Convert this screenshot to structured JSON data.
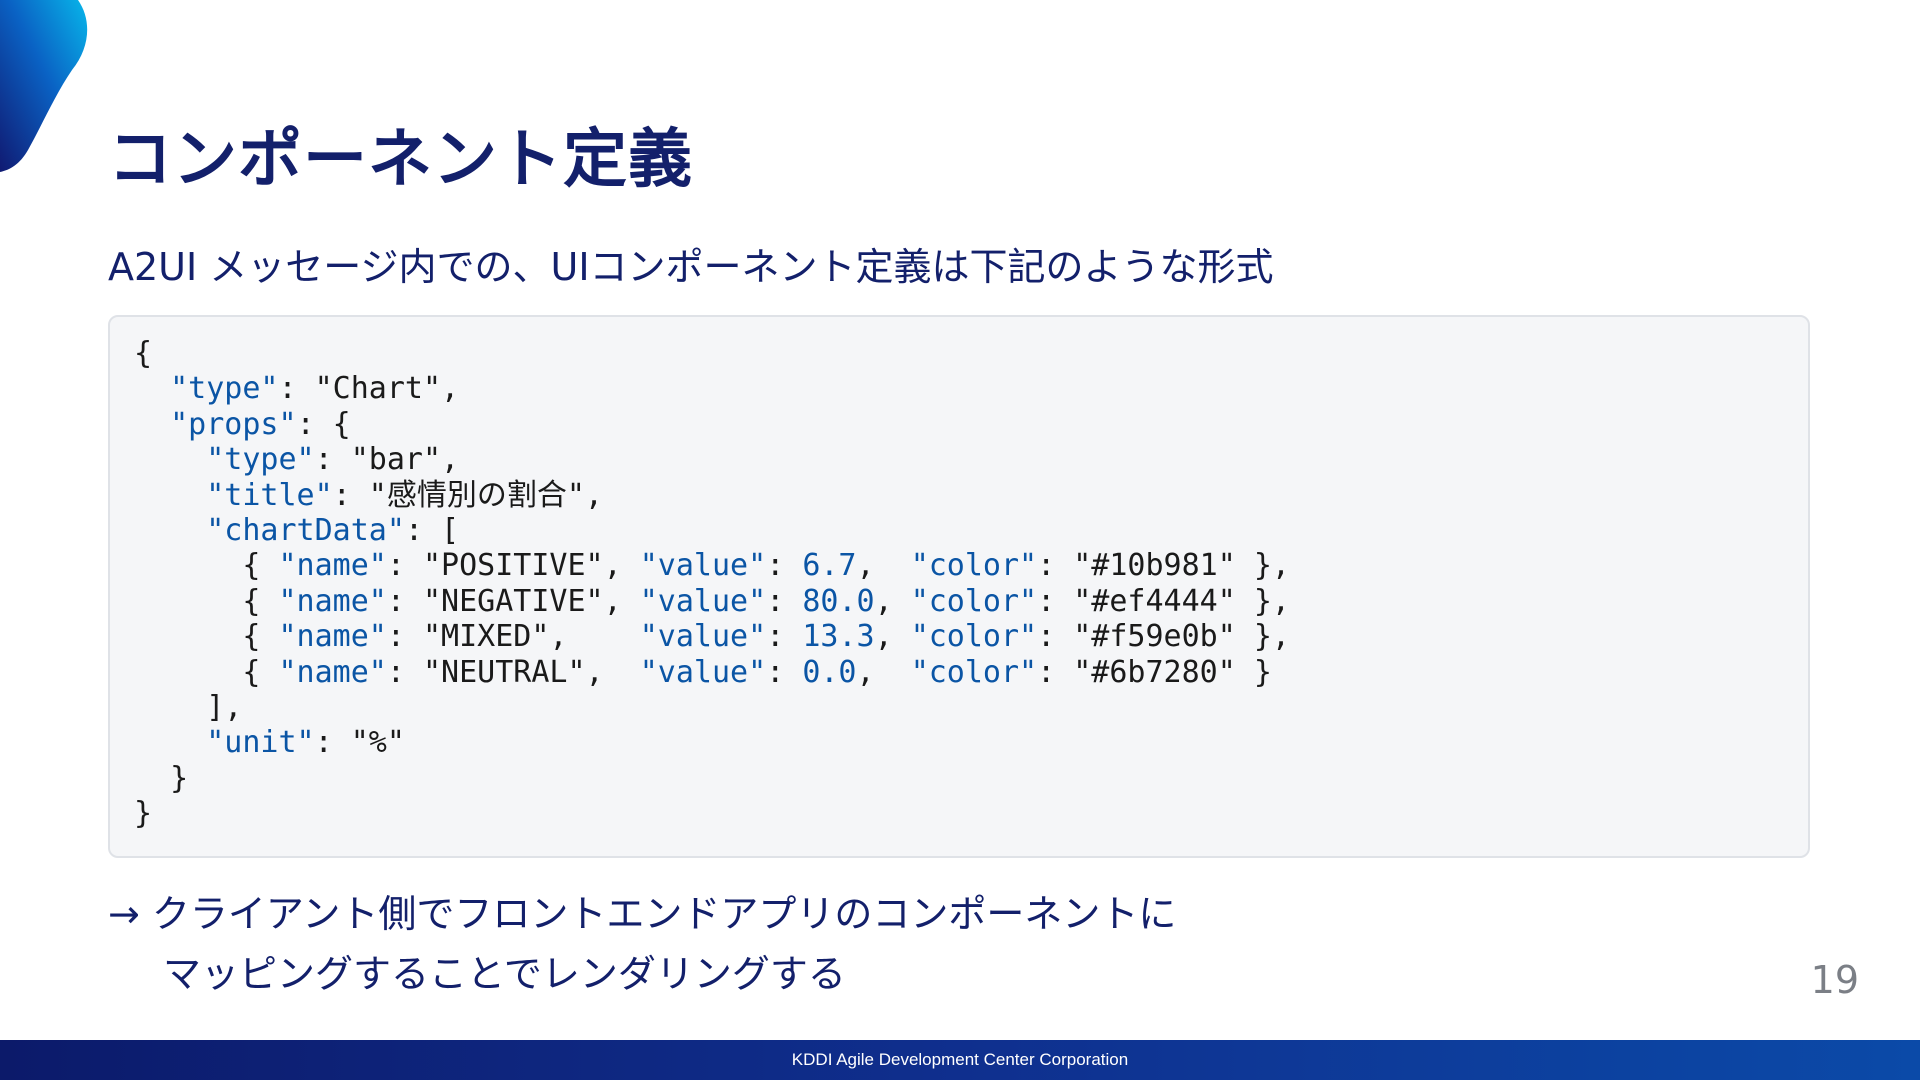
{
  "slide": {
    "title": "コンポーネント定義",
    "subtitle": "A2UI メッセージ内での、UIコンポーネント定義は下記のような形式",
    "conclusion_line1": "→ クライアント側でフロントエンドアプリのコンポーネントに",
    "conclusion_line2": "マッピングすることでレンダリングする",
    "page_number": "19"
  },
  "footer": {
    "company": "KDDI Agile Development Center Corporation"
  },
  "code_example": {
    "lines": [
      "{",
      "  \"type\": \"Chart\",",
      "  \"props\": {",
      "    \"type\": \"bar\",",
      "    \"title\": \"感情別の割合\",",
      "    \"chartData\": [",
      "      { \"name\": \"POSITIVE\", \"value\": 6.7,  \"color\": \"#10b981\" },",
      "      { \"name\": \"NEGATIVE\", \"value\": 80.0, \"color\": \"#ef4444\" },",
      "      { \"name\": \"MIXED\",    \"value\": 13.3, \"color\": \"#f59e0b\" },",
      "      { \"name\": \"NEUTRAL\",  \"value\": 0.0,  \"color\": \"#6b7280\" }",
      "    ],",
      "    \"unit\": \"%\"",
      "  }",
      "}"
    ]
  },
  "colors": {
    "title": "#13206b",
    "key": "#0b55a5",
    "code_background": "#f5f6f8",
    "footer_start": "#0c1a6a",
    "footer_end": "#0b4aa8"
  }
}
